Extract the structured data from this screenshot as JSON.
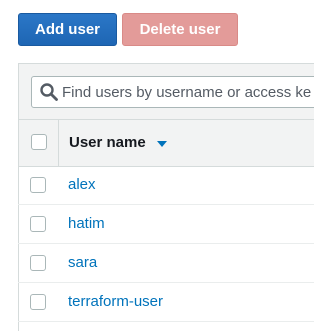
{
  "toolbar": {
    "add_user_label": "Add user",
    "delete_user_label": "Delete user"
  },
  "search": {
    "placeholder": "Find users by username or access ke",
    "icon": "search-icon"
  },
  "table": {
    "columns": [
      {
        "label": "User name",
        "sort": "descending"
      }
    ],
    "rows": [
      {
        "user_name": "alex"
      },
      {
        "user_name": "hatim"
      },
      {
        "user_name": "sara"
      },
      {
        "user_name": "terraform-user"
      }
    ]
  },
  "colors": {
    "primary_button": "#1e66b4",
    "disabled_danger_button": "#e39b99",
    "link": "#0073bb",
    "header_background": "#f2f3f3"
  }
}
